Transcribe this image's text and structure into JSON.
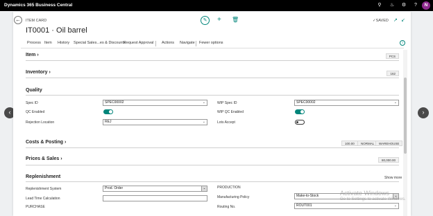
{
  "app": {
    "title": "Dynamics 365 Business Central",
    "user_initial": "N"
  },
  "header": {
    "card_label": "ITEM CARD",
    "title": "IT0001 · Oil barrel",
    "saved_label": "✓SAVED"
  },
  "actions": [
    "Process",
    "Item",
    "History",
    "Special Sales...es & Discounts",
    "Request Approval",
    "Actions",
    "Navigate",
    "Fewer options"
  ],
  "sections": {
    "item": {
      "title": "Item",
      "badge": "PCS"
    },
    "inventory": {
      "title": "Inventory",
      "badge": "162"
    },
    "quality": {
      "title": "Quality",
      "spec_id_label": "Spec ID",
      "spec_id_value": "SPEC00002",
      "qc_enabled_label": "QC Enabled",
      "qc_enabled": true,
      "rejection_location_label": "Rejection Location",
      "rejection_location_value": "REJ",
      "wip_spec_id_label": "WIP Spec ID",
      "wip_spec_id_value": "SPEC00002",
      "wip_qc_enabled_label": "WIP QC Enabled",
      "wip_qc_enabled": true,
      "lots_accept_label": "Lots Accept",
      "lots_accept": false
    },
    "costs_posting": {
      "title": "Costs & Posting",
      "badges": [
        "100.00",
        "NORMAL",
        "WAREHOUSE"
      ]
    },
    "prices_sales": {
      "title": "Prices & Sales",
      "badge": "80,000.00"
    },
    "replenishment": {
      "title": "Replenishment",
      "show_more": "Show more",
      "replenishment_system_label": "Replenishment System",
      "replenishment_system_value": "Prod. Order",
      "lead_time_label": "Lead Time Calculation",
      "lead_time_value": "",
      "purchase_label": "PURCHASE",
      "production_label": "PRODUCTION",
      "manufacturing_policy_label": "Manufacturing Policy",
      "manufacturing_policy_value": "Make-to-Stock",
      "routing_no_label": "Routing No.",
      "routing_no_value": "ROUT001"
    }
  },
  "watermark": {
    "line1": "Activate Windows",
    "line2": "Go to Settings to activate Windows."
  }
}
